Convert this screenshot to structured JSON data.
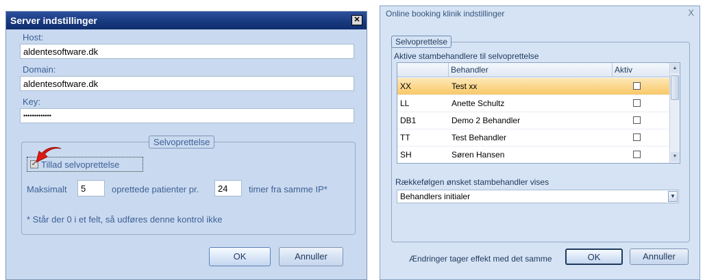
{
  "server_dialog": {
    "title": "Server indstillinger",
    "close_glyph": "✕",
    "host_label": "Host:",
    "host_value": "aldentesoftware.dk",
    "domain_label": "Domain:",
    "domain_value": "aldentesoftware.dk",
    "key_label": "Key:",
    "key_value": "•••••••••••••",
    "group_label": "Selvoprettelse",
    "allow_checkbox_label": "Tillad selvoprettelse",
    "allow_checked": true,
    "max_label": "Maksimalt",
    "max_value": "5",
    "patients_label": "oprettede patienter pr.",
    "hours_value": "24",
    "hours_label": "timer fra samme IP*",
    "note": "* Står der 0 i et felt, så udføres denne kontrol ikke",
    "ok_label": "OK",
    "cancel_label": "Annuller"
  },
  "clinic_dialog": {
    "title": "Online booking klinik indstillinger",
    "close_glyph": "X",
    "group_label": "Selvoprettelse",
    "active_label": "Aktive stambehandlere til selvoprettelse",
    "columns": {
      "code": "",
      "name": "Behandler",
      "active": "Aktiv"
    },
    "rows": [
      {
        "code": "XX",
        "name": "Test xx",
        "active": false,
        "selected": true
      },
      {
        "code": "LL",
        "name": "Anette Schultz",
        "active": false,
        "selected": false
      },
      {
        "code": "DB1",
        "name": "Demo 2 Behandler",
        "active": false,
        "selected": false
      },
      {
        "code": "TT",
        "name": "Test Behandler",
        "active": false,
        "selected": false
      },
      {
        "code": "SH",
        "name": "Søren Hansen",
        "active": false,
        "selected": false
      }
    ],
    "order_label": "Rækkefølgen ønsket stambehandler vises",
    "order_value": "Behandlers initialer",
    "effect_note": "Ændringer tager effekt med det samme",
    "ok_label": "OK",
    "cancel_label": "Annuller"
  }
}
